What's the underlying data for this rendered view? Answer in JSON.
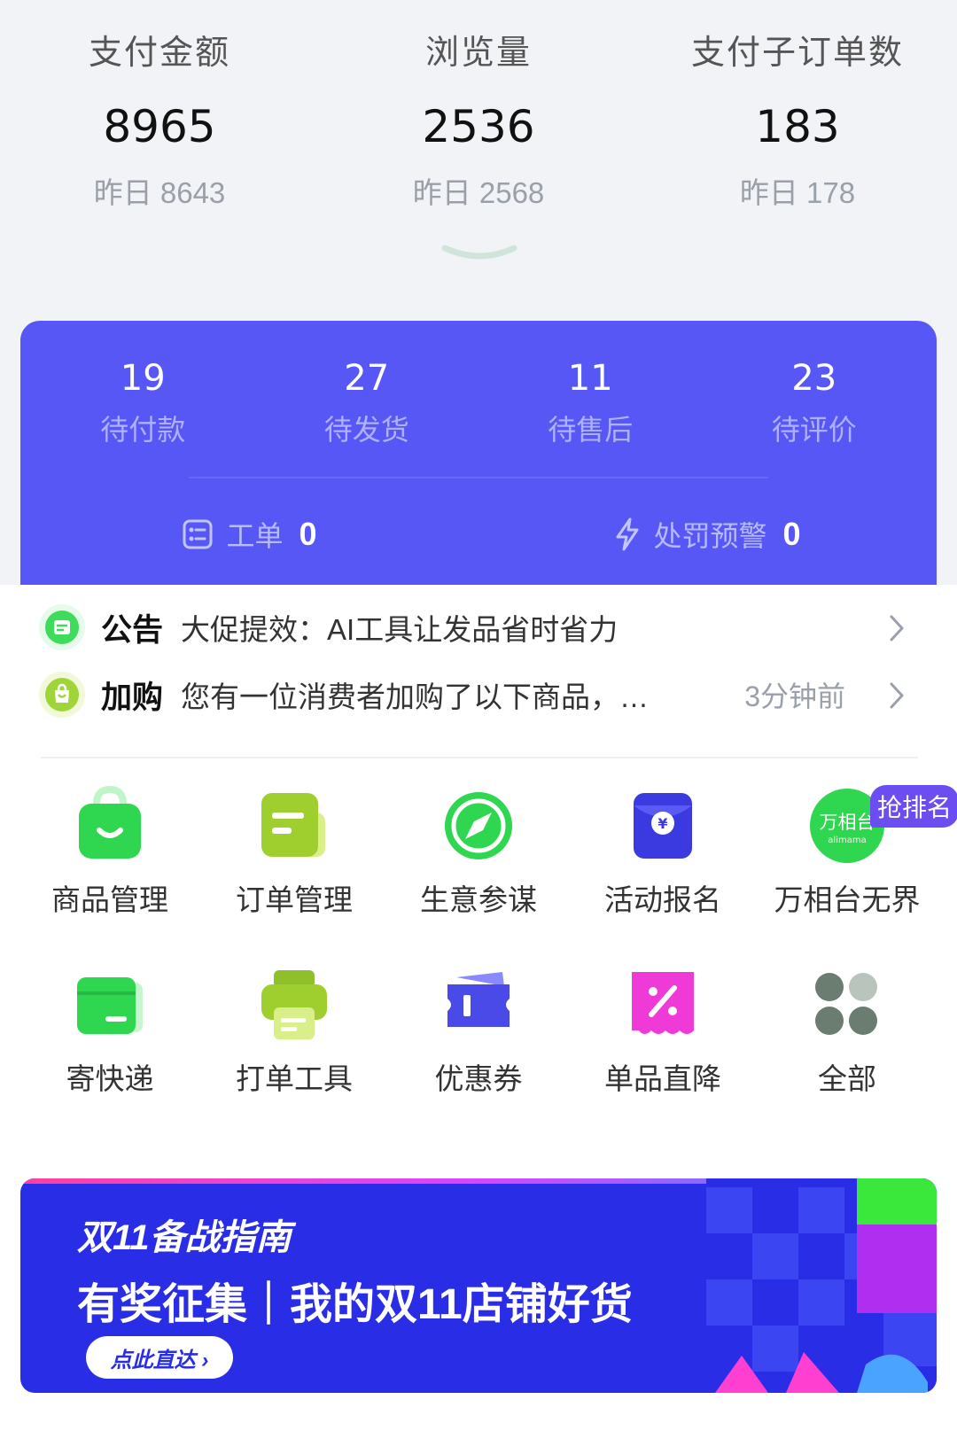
{
  "metrics": [
    {
      "label": "支付金额",
      "value": "8965",
      "yesterday": "昨日 8643"
    },
    {
      "label": "浏览量",
      "value": "2536",
      "yesterday": "昨日 2568"
    },
    {
      "label": "支付子订单数",
      "value": "183",
      "yesterday": "昨日 178"
    }
  ],
  "order_counts": [
    {
      "count": "19",
      "label": "待付款"
    },
    {
      "count": "27",
      "label": "待发货"
    },
    {
      "count": "11",
      "label": "待售后"
    },
    {
      "count": "23",
      "label": "待评价"
    }
  ],
  "card_links": {
    "tickets": {
      "label": "工单",
      "count": "0"
    },
    "penalty": {
      "label": "处罚预警",
      "count": "0"
    }
  },
  "notices": [
    {
      "tag": "公告",
      "message": "大促提效：AI工具让发品省时省力",
      "time": ""
    },
    {
      "tag": "加购",
      "message": "您有一位消费者加购了以下商品，…",
      "time": "3分钟前"
    }
  ],
  "tools": {
    "row1": [
      {
        "label": "商品管理",
        "icon": "shopping-bag-icon"
      },
      {
        "label": "订单管理",
        "icon": "order-doc-icon"
      },
      {
        "label": "生意参谋",
        "icon": "compass-icon"
      },
      {
        "label": "活动报名",
        "icon": "yen-envelope-icon"
      },
      {
        "label": "万相台无界",
        "icon": "wanxiangtai-logo-icon",
        "badge": "抢排名",
        "logo_text": "万相台",
        "logo_sub": "alimama"
      }
    ],
    "row2": [
      {
        "label": "寄快递",
        "icon": "express-box-icon"
      },
      {
        "label": "打单工具",
        "icon": "printer-icon"
      },
      {
        "label": "优惠券",
        "icon": "coupon-icon"
      },
      {
        "label": "单品直降",
        "icon": "discount-tag-icon"
      },
      {
        "label": "全部",
        "icon": "all-dots-icon"
      }
    ]
  },
  "banner": {
    "title": "双11备战指南",
    "subtitle": "有奖征集｜我的双11店铺好货",
    "button": "点此直达 ›"
  },
  "colors": {
    "card_bg": "#5757f5",
    "green": "#2fd64f",
    "banner_bg": "#2a2de6"
  }
}
